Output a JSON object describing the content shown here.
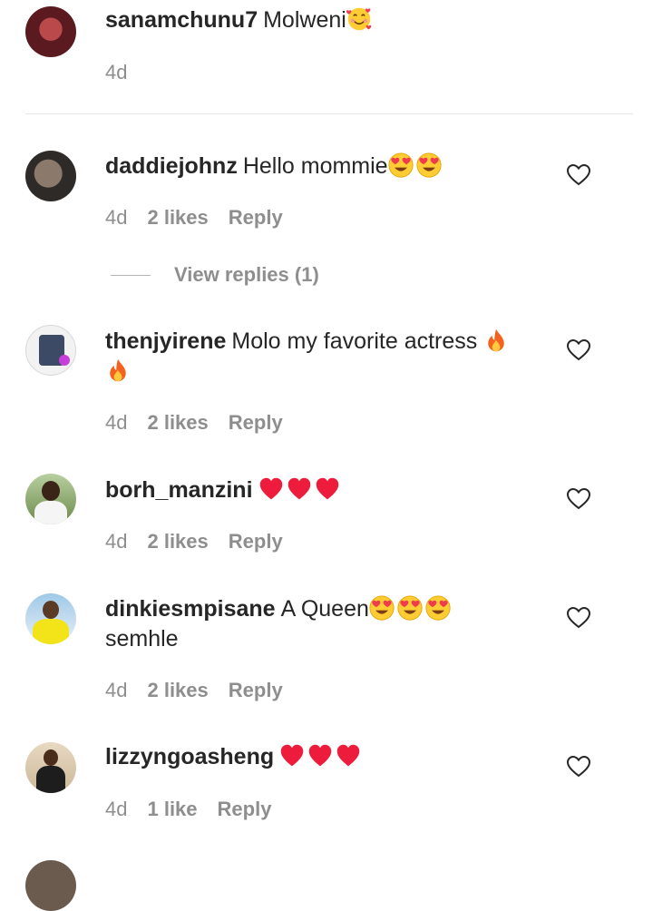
{
  "comments": [
    {
      "username": "sanamchunu7",
      "text": "Molweni",
      "time": "4d",
      "likes": "",
      "reply": ""
    },
    {
      "username": "daddiejohnz",
      "text": "Hello mommie",
      "time": "4d",
      "likes": "2 likes",
      "reply": "Reply"
    },
    {
      "username": "thenjyirene",
      "text": "Molo my favorite actress",
      "time": "4d",
      "likes": "2 likes",
      "reply": "Reply"
    },
    {
      "username": "borh_manzini",
      "text": "",
      "time": "4d",
      "likes": "2 likes",
      "reply": "Reply"
    },
    {
      "username": "dinkiesmpisane",
      "text": "A Queen",
      "text2": "semhle",
      "time": "4d",
      "likes": "2 likes",
      "reply": "Reply"
    },
    {
      "username": "lizzyngoasheng",
      "text": "",
      "time": "4d",
      "likes": "1 like",
      "reply": "Reply"
    }
  ],
  "view_replies": "View replies (1)",
  "colors": {
    "text": "#262626",
    "meta": "#8e8e8e",
    "heart_red": "#ed1c3d"
  },
  "icons": [
    "heart-outline-icon",
    "heart-eyes-emoji",
    "smiling-face-with-hearts-emoji",
    "fire-emoji",
    "red-heart-emoji"
  ]
}
